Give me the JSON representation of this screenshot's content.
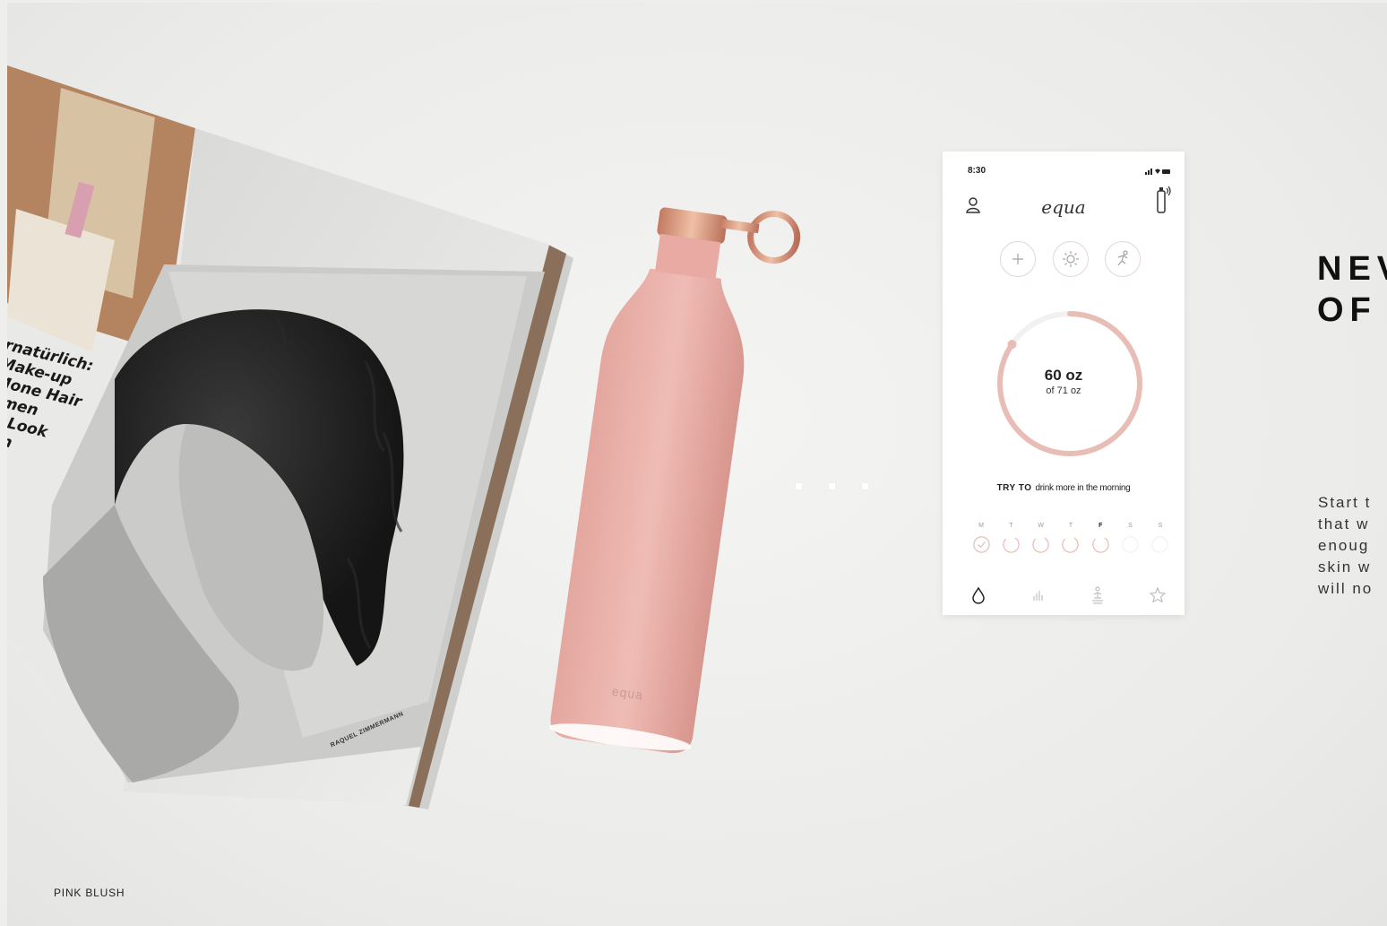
{
  "magazine": {
    "headline_lines": [
      "rnatürlich:",
      "Make-up",
      "Mone Hair",
      "umen",
      "ly-Look",
      "son"
    ],
    "credit": "RAQUEL ZIMMERMANN"
  },
  "bottle": {
    "logo": "equa",
    "color": "#e9b1ab",
    "cap_color": "#d99b84"
  },
  "phone": {
    "status_time": "8:30",
    "logo": "equa",
    "intake_value": "60 oz",
    "intake_goal": "of 71 oz",
    "progress": 0.845,
    "accent": "#e8bdb6",
    "tip_strong": "TRY TO",
    "tip_text": "drink more in the morning",
    "days": [
      {
        "label": "M",
        "state": "done"
      },
      {
        "label": "T",
        "state": "partial"
      },
      {
        "label": "W",
        "state": "partial"
      },
      {
        "label": "T",
        "state": "partial"
      },
      {
        "label": "F",
        "state": "partial",
        "current": true
      },
      {
        "label": "S",
        "state": "future"
      },
      {
        "label": "S",
        "state": "future"
      }
    ],
    "quick_actions": [
      "plus-icon",
      "sun-icon",
      "activity-icon"
    ],
    "nav": [
      "drop-icon",
      "stats-icon",
      "meditation-icon",
      "star-icon"
    ]
  },
  "headline": "NEV\nOF",
  "body_lines": [
    "Start t",
    "that w",
    "enoug",
    "skin w",
    "will no"
  ],
  "caption": "PINK BLUSH"
}
